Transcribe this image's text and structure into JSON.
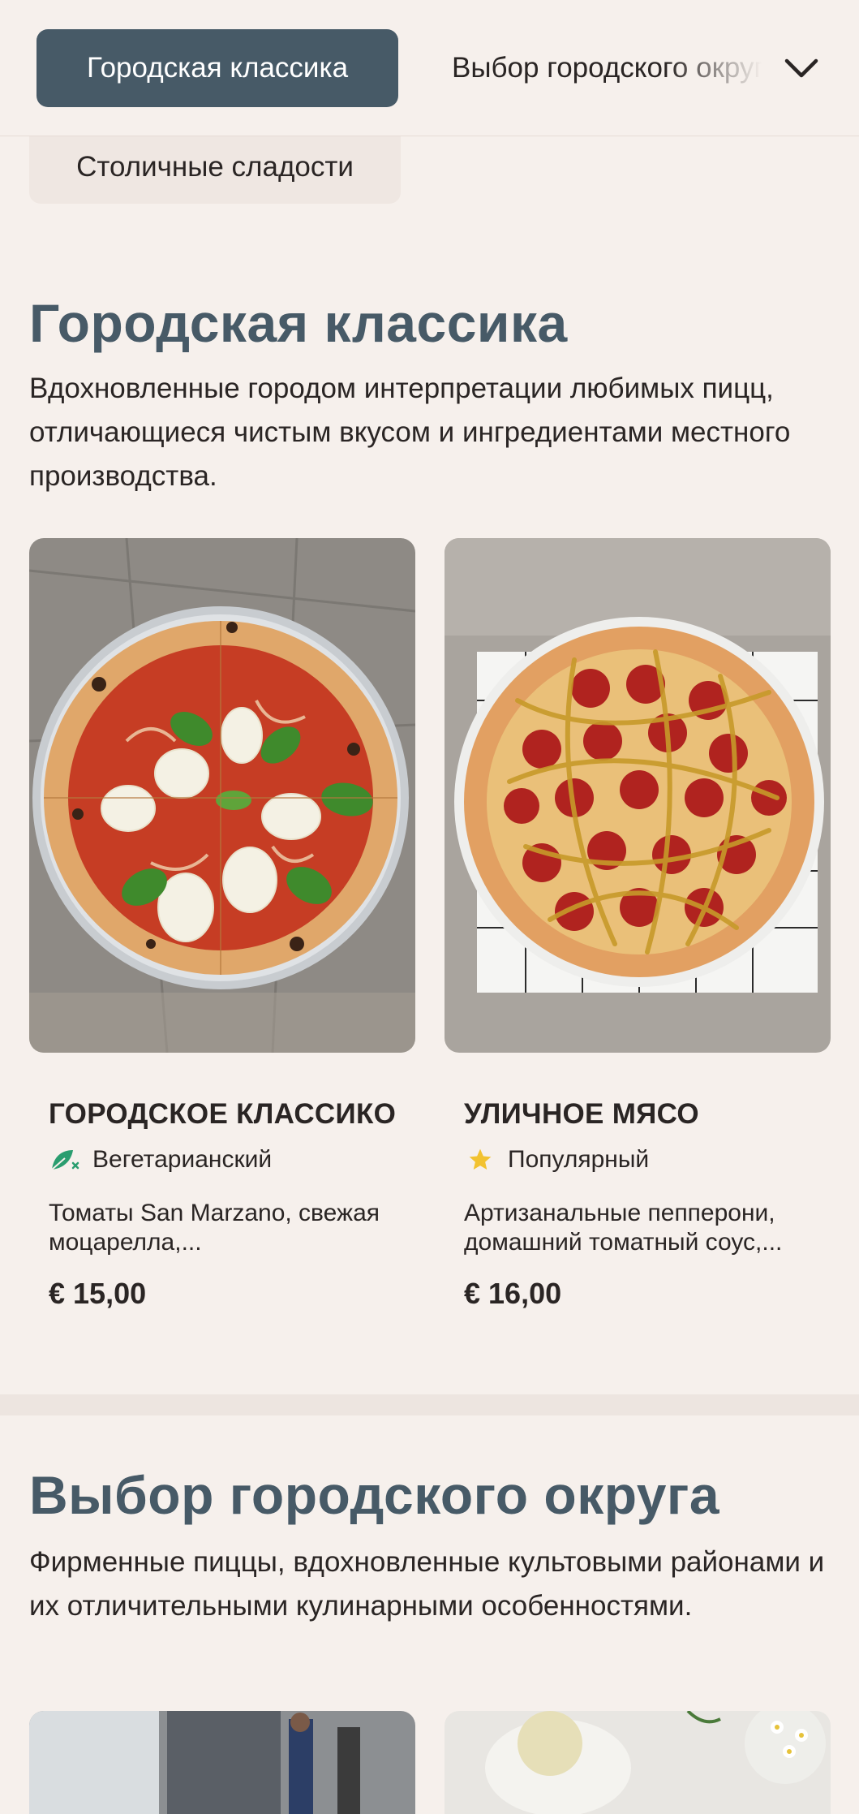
{
  "nav": {
    "active_category": "Городская классика",
    "next_category": "Выбор городского округа",
    "secondary_category": "Столичные сладости",
    "chevron_icon": "chevron-down-icon"
  },
  "sections": [
    {
      "title": "Городская классика",
      "description": "Вдохновленные городом интерпретации любимых пицц, отличающиеся чистым вкусом и ингредиентами местного производства.",
      "products": [
        {
          "name": "ГОРОДСКОЕ КЛАССИКО",
          "badge": "Вегетарианский",
          "badge_icon": "vegetarian-leaf-icon",
          "badge_color": "#2a9d6f",
          "description": "Томаты San Marzano, свежая моцарелла,...",
          "price": "€ 15,00",
          "image": "margherita-pizza-photo"
        },
        {
          "name": "УЛИЧНОЕ МЯСО",
          "badge": "Популярный",
          "badge_icon": "star-icon",
          "badge_color": "#f2c230",
          "description": "Артизанальные пепперони, домашний томатный соус,...",
          "price": "€ 16,00",
          "image": "pepperoni-pizza-photo"
        }
      ]
    },
    {
      "title": "Выбор городского округа",
      "description": "Фирменные пиццы, вдохновленные культовыми районами и их отличительными кулинарными особенностями."
    }
  ],
  "colors": {
    "background": "#f6f0ec",
    "accent": "#475a67",
    "text": "#2a2524"
  }
}
